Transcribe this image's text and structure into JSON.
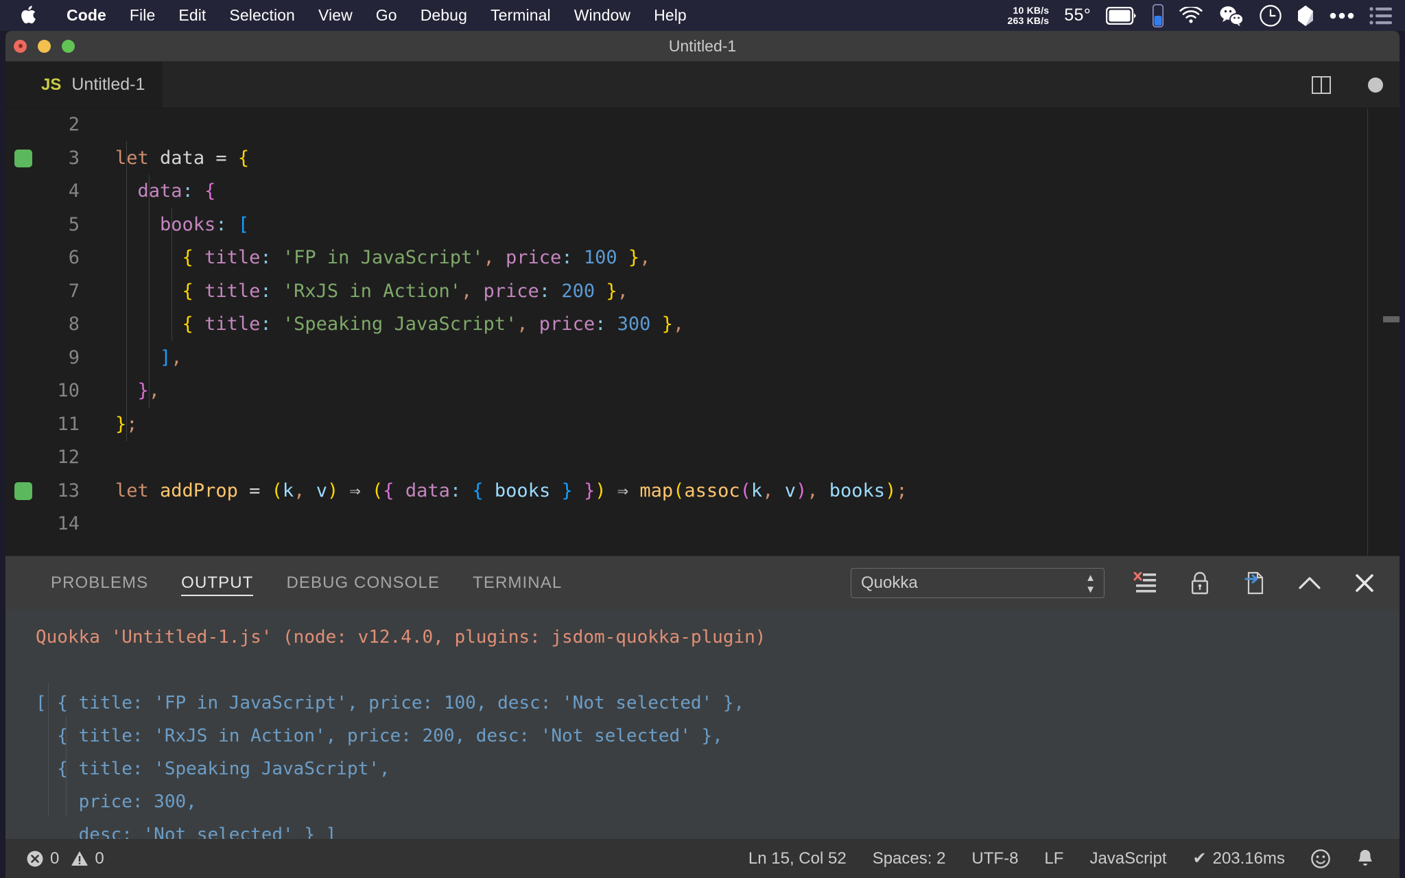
{
  "menubar": {
    "apple_icon": "apple-logo-icon",
    "items": [
      {
        "label": "Code",
        "bold": true
      },
      {
        "label": "File",
        "bold": false
      },
      {
        "label": "Edit",
        "bold": false
      },
      {
        "label": "Selection",
        "bold": false
      },
      {
        "label": "View",
        "bold": false
      },
      {
        "label": "Go",
        "bold": false
      },
      {
        "label": "Debug",
        "bold": false
      },
      {
        "label": "Terminal",
        "bold": false
      },
      {
        "label": "Window",
        "bold": false
      },
      {
        "label": "Help",
        "bold": false
      }
    ],
    "status": {
      "net_up": "10 KB/s",
      "net_down": "263 KB/s",
      "temperature": "55°",
      "icons": [
        "battery-icon",
        "battery-gauge-icon",
        "wifi-icon",
        "wechat-icon",
        "clock-icon",
        "pocket-icon",
        "ellipsis-icon",
        "control-center-icon"
      ]
    }
  },
  "window": {
    "title": "Untitled-1",
    "traffic_lights": [
      "close-button",
      "minimize-button",
      "zoom-button"
    ]
  },
  "tabs": {
    "items": [
      {
        "badge": "JS",
        "label": "Untitled-1",
        "active": true
      }
    ],
    "actions": [
      "split-editor-icon",
      "unsaved-dot-icon"
    ]
  },
  "editor": {
    "first_line": 2,
    "lines": [
      {
        "num": "2",
        "marker": false,
        "indent": 0,
        "tokens": []
      },
      {
        "num": "3",
        "marker": true,
        "indent": 0,
        "tokens": [
          {
            "t": "let",
            "c": "t-key"
          },
          {
            "t": " ",
            "c": "t-plain"
          },
          {
            "t": "data",
            "c": "t-plain"
          },
          {
            "t": " ",
            "c": "t-plain"
          },
          {
            "t": "=",
            "c": "t-plain"
          },
          {
            "t": " ",
            "c": "t-plain"
          },
          {
            "t": "{",
            "c": "t-br1"
          }
        ]
      },
      {
        "num": "4",
        "marker": false,
        "indent": 1,
        "tokens": [
          {
            "t": "  ",
            "c": "t-plain"
          },
          {
            "t": "data",
            "c": "t-prop"
          },
          {
            "t": ":",
            "c": "t-colon"
          },
          {
            "t": " ",
            "c": "t-plain"
          },
          {
            "t": "{",
            "c": "t-br2"
          }
        ]
      },
      {
        "num": "5",
        "marker": false,
        "indent": 2,
        "tokens": [
          {
            "t": "    ",
            "c": "t-plain"
          },
          {
            "t": "books",
            "c": "t-prop"
          },
          {
            "t": ":",
            "c": "t-colon"
          },
          {
            "t": " ",
            "c": "t-plain"
          },
          {
            "t": "[",
            "c": "t-br3"
          }
        ]
      },
      {
        "num": "6",
        "marker": false,
        "indent": 3,
        "tokens": [
          {
            "t": "      ",
            "c": "t-plain"
          },
          {
            "t": "{",
            "c": "t-br1"
          },
          {
            "t": " ",
            "c": "t-plain"
          },
          {
            "t": "title",
            "c": "t-prop"
          },
          {
            "t": ":",
            "c": "t-colon"
          },
          {
            "t": " ",
            "c": "t-plain"
          },
          {
            "t": "'FP in JavaScript'",
            "c": "t-str"
          },
          {
            "t": ",",
            "c": "t-comma"
          },
          {
            "t": " ",
            "c": "t-plain"
          },
          {
            "t": "price",
            "c": "t-prop"
          },
          {
            "t": ":",
            "c": "t-colon"
          },
          {
            "t": " ",
            "c": "t-plain"
          },
          {
            "t": "100",
            "c": "t-num"
          },
          {
            "t": " ",
            "c": "t-plain"
          },
          {
            "t": "}",
            "c": "t-br1"
          },
          {
            "t": ",",
            "c": "t-comma"
          }
        ]
      },
      {
        "num": "7",
        "marker": false,
        "indent": 3,
        "tokens": [
          {
            "t": "      ",
            "c": "t-plain"
          },
          {
            "t": "{",
            "c": "t-br1"
          },
          {
            "t": " ",
            "c": "t-plain"
          },
          {
            "t": "title",
            "c": "t-prop"
          },
          {
            "t": ":",
            "c": "t-colon"
          },
          {
            "t": " ",
            "c": "t-plain"
          },
          {
            "t": "'RxJS in Action'",
            "c": "t-str"
          },
          {
            "t": ",",
            "c": "t-comma"
          },
          {
            "t": " ",
            "c": "t-plain"
          },
          {
            "t": "price",
            "c": "t-prop"
          },
          {
            "t": ":",
            "c": "t-colon"
          },
          {
            "t": " ",
            "c": "t-plain"
          },
          {
            "t": "200",
            "c": "t-num"
          },
          {
            "t": " ",
            "c": "t-plain"
          },
          {
            "t": "}",
            "c": "t-br1"
          },
          {
            "t": ",",
            "c": "t-comma"
          }
        ]
      },
      {
        "num": "8",
        "marker": false,
        "indent": 3,
        "tokens": [
          {
            "t": "      ",
            "c": "t-plain"
          },
          {
            "t": "{",
            "c": "t-br1"
          },
          {
            "t": " ",
            "c": "t-plain"
          },
          {
            "t": "title",
            "c": "t-prop"
          },
          {
            "t": ":",
            "c": "t-colon"
          },
          {
            "t": " ",
            "c": "t-plain"
          },
          {
            "t": "'Speaking JavaScript'",
            "c": "t-str"
          },
          {
            "t": ",",
            "c": "t-comma"
          },
          {
            "t": " ",
            "c": "t-plain"
          },
          {
            "t": "price",
            "c": "t-prop"
          },
          {
            "t": ":",
            "c": "t-colon"
          },
          {
            "t": " ",
            "c": "t-plain"
          },
          {
            "t": "300",
            "c": "t-num"
          },
          {
            "t": " ",
            "c": "t-plain"
          },
          {
            "t": "}",
            "c": "t-br1"
          },
          {
            "t": ",",
            "c": "t-comma"
          }
        ]
      },
      {
        "num": "9",
        "marker": false,
        "indent": 2,
        "tokens": [
          {
            "t": "    ",
            "c": "t-plain"
          },
          {
            "t": "]",
            "c": "t-br3"
          },
          {
            "t": ",",
            "c": "t-comma"
          }
        ]
      },
      {
        "num": "10",
        "marker": false,
        "indent": 1,
        "tokens": [
          {
            "t": "  ",
            "c": "t-plain"
          },
          {
            "t": "}",
            "c": "t-br2"
          },
          {
            "t": ",",
            "c": "t-comma"
          }
        ]
      },
      {
        "num": "11",
        "marker": false,
        "indent": 0,
        "tokens": [
          {
            "t": "}",
            "c": "t-br1"
          },
          {
            "t": ";",
            "c": "t-comma"
          }
        ]
      },
      {
        "num": "12",
        "marker": false,
        "indent": 0,
        "tokens": []
      },
      {
        "num": "13",
        "marker": true,
        "indent": 0,
        "tokens": [
          {
            "t": "let",
            "c": "t-key"
          },
          {
            "t": " ",
            "c": "t-plain"
          },
          {
            "t": "addProp",
            "c": "t-fn"
          },
          {
            "t": " ",
            "c": "t-plain"
          },
          {
            "t": "=",
            "c": "t-plain"
          },
          {
            "t": " ",
            "c": "t-plain"
          },
          {
            "t": "(",
            "c": "t-br1"
          },
          {
            "t": "k",
            "c": "t-var"
          },
          {
            "t": ",",
            "c": "t-comma"
          },
          {
            "t": " ",
            "c": "t-plain"
          },
          {
            "t": "v",
            "c": "t-var"
          },
          {
            "t": ")",
            "c": "t-br1"
          },
          {
            "t": " ",
            "c": "t-plain"
          },
          {
            "t": "⇒",
            "c": "t-arrow"
          },
          {
            "t": " ",
            "c": "t-plain"
          },
          {
            "t": "(",
            "c": "t-br1"
          },
          {
            "t": "{",
            "c": "t-br2"
          },
          {
            "t": " ",
            "c": "t-plain"
          },
          {
            "t": "data",
            "c": "t-prop"
          },
          {
            "t": ":",
            "c": "t-colon"
          },
          {
            "t": " ",
            "c": "t-plain"
          },
          {
            "t": "{",
            "c": "t-br3"
          },
          {
            "t": " ",
            "c": "t-plain"
          },
          {
            "t": "books",
            "c": "t-var"
          },
          {
            "t": " ",
            "c": "t-plain"
          },
          {
            "t": "}",
            "c": "t-br3"
          },
          {
            "t": " ",
            "c": "t-plain"
          },
          {
            "t": "}",
            "c": "t-br2"
          },
          {
            "t": ")",
            "c": "t-br1"
          },
          {
            "t": " ",
            "c": "t-plain"
          },
          {
            "t": "⇒",
            "c": "t-arrow"
          },
          {
            "t": " ",
            "c": "t-plain"
          },
          {
            "t": "map",
            "c": "t-fn"
          },
          {
            "t": "(",
            "c": "t-br1"
          },
          {
            "t": "assoc",
            "c": "t-fn"
          },
          {
            "t": "(",
            "c": "t-br2"
          },
          {
            "t": "k",
            "c": "t-var"
          },
          {
            "t": ",",
            "c": "t-comma"
          },
          {
            "t": " ",
            "c": "t-plain"
          },
          {
            "t": "v",
            "c": "t-var"
          },
          {
            "t": ")",
            "c": "t-br2"
          },
          {
            "t": ",",
            "c": "t-comma"
          },
          {
            "t": " ",
            "c": "t-plain"
          },
          {
            "t": "books",
            "c": "t-var"
          },
          {
            "t": ")",
            "c": "t-br1"
          },
          {
            "t": ";",
            "c": "t-comma"
          }
        ]
      },
      {
        "num": "14",
        "marker": false,
        "indent": 0,
        "tokens": []
      }
    ]
  },
  "panel": {
    "tabs": [
      {
        "label": "PROBLEMS",
        "active": false
      },
      {
        "label": "OUTPUT",
        "active": true
      },
      {
        "label": "DEBUG CONSOLE",
        "active": false
      },
      {
        "label": "TERMINAL",
        "active": false
      }
    ],
    "channel_select": {
      "value": "Quokka"
    },
    "actions": [
      {
        "name": "clear-output-icon"
      },
      {
        "name": "lock-scroll-icon"
      },
      {
        "name": "open-in-editor-icon"
      },
      {
        "name": "maximize-panel-icon"
      },
      {
        "name": "close-panel-icon"
      }
    ],
    "output": [
      {
        "text": "Quokka 'Untitled-1.js' (node: v12.4.0, plugins: jsdom-quokka-plugin)",
        "style": "o-head"
      },
      {
        "text": "",
        "style": "o-data"
      },
      {
        "text": "[ { title: 'FP in JavaScript', price: 100, desc: 'Not selected' },",
        "style": "o-data"
      },
      {
        "text": "  { title: 'RxJS in Action', price: 200, desc: 'Not selected' },",
        "style": "o-data"
      },
      {
        "text": "  { title: 'Speaking JavaScript',",
        "style": "o-data"
      },
      {
        "text": "    price: 300,",
        "style": "o-data"
      },
      {
        "text": "    desc: 'Not selected' } ]",
        "style": "o-data"
      }
    ]
  },
  "statusbar": {
    "errors": "0",
    "warnings": "0",
    "position": "Ln 15, Col 52",
    "spaces": "Spaces: 2",
    "encoding": "UTF-8",
    "eol": "LF",
    "language": "JavaScript",
    "quokka_time": "203.16ms",
    "quokka_check": "✔",
    "feedback_icon": "smiley-icon",
    "bell_icon": "bell-icon"
  }
}
